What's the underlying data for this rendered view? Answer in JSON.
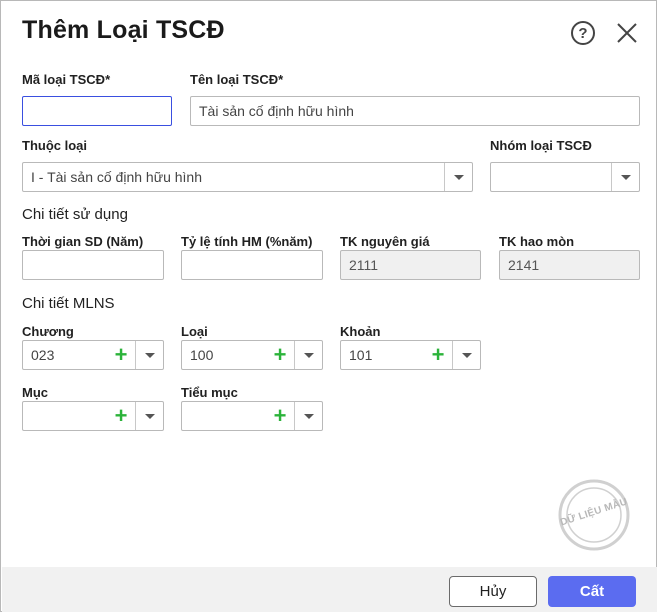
{
  "dialog": {
    "title": "Thêm Loại TSCĐ",
    "help_icon": "question-circle-icon",
    "close_icon": "close-x-icon"
  },
  "fields": {
    "ma_loai": {
      "label": "Mã loại TSCĐ",
      "required_mark": "*",
      "value": ""
    },
    "ten_loai": {
      "label": "Tên loại TSCĐ",
      "required_mark": "*",
      "value": "Tài sản cố định hữu hình"
    },
    "thuoc_loai": {
      "label": "Thuộc loại",
      "value": "I - Tài sản cố định hữu hình"
    },
    "nhom_loai": {
      "label": "Nhóm loại TSCĐ",
      "value": ""
    }
  },
  "section_usage": {
    "title": "Chi tiết sử dụng",
    "thoi_gian": {
      "label": "Thời gian SD (Năm)",
      "value": ""
    },
    "ty_le": {
      "label": "Tỷ lệ tính HM (%năm)",
      "value": ""
    },
    "tk_nguyen_gia": {
      "label": "TK nguyên giá",
      "value": "2111"
    },
    "tk_hao_mon": {
      "label": "TK hao mòn",
      "value": "2141"
    }
  },
  "section_mlns": {
    "title": "Chi tiết MLNS",
    "chuong": {
      "label": "Chương",
      "value": "023"
    },
    "loai": {
      "label": "Loại",
      "value": "100"
    },
    "khoan": {
      "label": "Khoản",
      "value": "101"
    },
    "muc": {
      "label": "Mục",
      "value": ""
    },
    "tieu_muc": {
      "label": "Tiểu mục",
      "value": ""
    }
  },
  "footer": {
    "cancel_label": "Hủy",
    "save_label": "Cất"
  },
  "watermark": {
    "text": "DỮ LIỆU MẪU"
  },
  "colors": {
    "primary": "#5b6cf0",
    "focus_border": "#3a4fe0",
    "plus_green": "#2bb33a",
    "footer_bg": "#f1f1f1"
  }
}
